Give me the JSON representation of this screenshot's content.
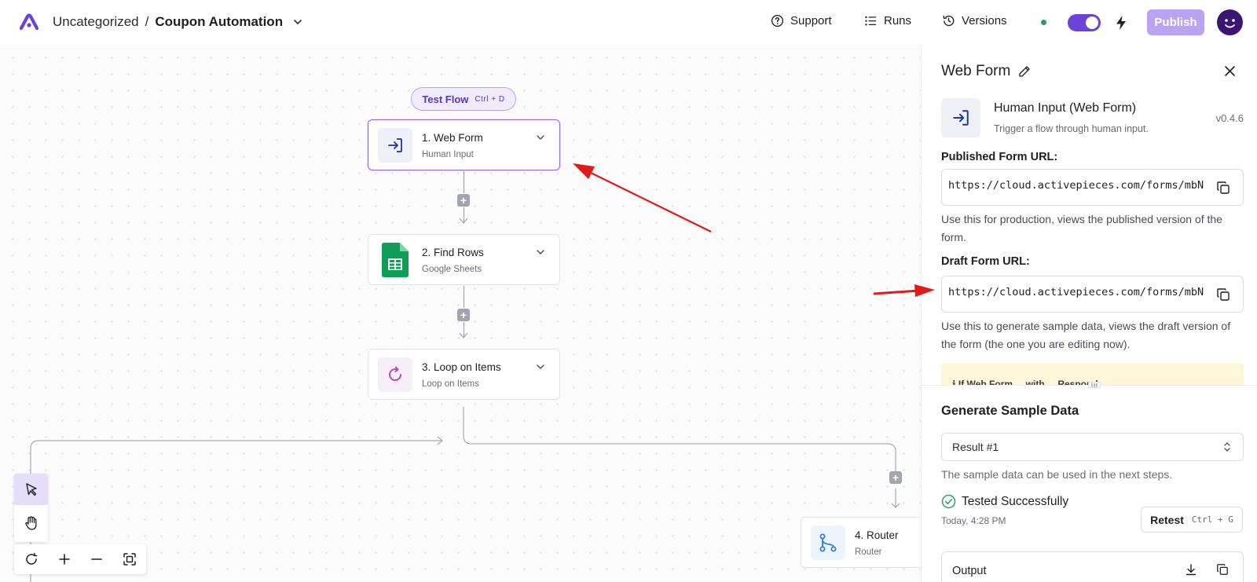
{
  "header": {
    "folder": "Uncategorized",
    "separator": "/",
    "flow_name": "Coupon Automation",
    "support_label": "Support",
    "runs_label": "Runs",
    "versions_label": "Versions",
    "publish_label": "Publish",
    "enabled": true
  },
  "canvas": {
    "test_flow_label": "Test Flow",
    "test_flow_shortcut": "Ctrl + D",
    "steps": [
      {
        "title": "1. Web Form",
        "subtitle": "Human Input"
      },
      {
        "title": "2. Find Rows",
        "subtitle": "Google Sheets"
      },
      {
        "title": "3. Loop on Items",
        "subtitle": "Loop on Items"
      },
      {
        "title": "4. Router",
        "subtitle": "Router"
      }
    ]
  },
  "panel": {
    "title": "Web Form",
    "piece_name": "Human Input (Web Form)",
    "piece_description": "Trigger a flow through human input.",
    "piece_version": "v0.4.6",
    "published_label": "Published Form URL:",
    "published_url": "https://cloud.activepieces.com/forms/mbNM",
    "published_help": "Use this for production, views the published version of the form.",
    "draft_label": "Draft Form URL:",
    "draft_url": "https://cloud.activepieces.com/forms/mbNM",
    "draft_help": "Use this to generate sample data, views the draft version of the form (the one you are editing now).",
    "notice_partial": "ℹ  If Web Form ... with ... Respond",
    "sample_title": "Generate Sample Data",
    "sample_select_value": "Result #1",
    "sample_help": "The sample data can be used in the next steps.",
    "tested_label": "Tested Successfully",
    "tested_time": "Today, 4:28 PM",
    "retest_label": "Retest",
    "retest_shortcut": "Ctrl + G",
    "output_label": "Output"
  },
  "colors": {
    "accent": "#6d42d9",
    "publish_bg": "#b9a4f3",
    "success": "#22a06b",
    "annotation_arrow": "#e01b1b"
  }
}
